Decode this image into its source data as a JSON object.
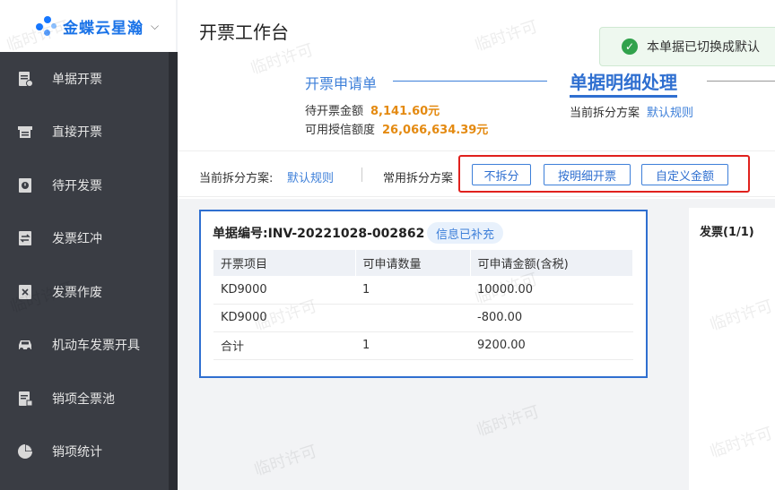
{
  "app": {
    "logo_text": "金蝶云星瀚",
    "page_title": "开票工作台",
    "watermark": "临时许可"
  },
  "sidebar": {
    "items": [
      {
        "label": "单据开票",
        "icon": "document-icon"
      },
      {
        "label": "直接开票",
        "icon": "printer-icon"
      },
      {
        "label": "待开发票",
        "icon": "pending-invoice-icon"
      },
      {
        "label": "发票红冲",
        "icon": "swap-icon"
      },
      {
        "label": "发票作废",
        "icon": "void-icon"
      },
      {
        "label": "机动车发票开具",
        "icon": "car-icon"
      },
      {
        "label": "销项全票池",
        "icon": "invoice-pool-icon"
      },
      {
        "label": "销项统计",
        "icon": "pie-chart-icon"
      }
    ]
  },
  "toast": {
    "text": "本单据已切换成默认"
  },
  "steps": {
    "step1_label": "开票申请单",
    "step2_label": "单据明细处理",
    "pending_amount_label": "待开票金额",
    "pending_amount_value": "8,141.60元",
    "credit_label": "可用授信额度",
    "credit_value": "26,066,634.39元",
    "current_plan_label": "当前拆分方案",
    "current_plan_value": "默认规则"
  },
  "split_bar": {
    "current_label": "当前拆分方案:",
    "current_value": "默认规则",
    "common_label": "常用拆分方案",
    "options": [
      "不拆分",
      "按明细开票",
      "自定义金额"
    ]
  },
  "detail": {
    "doc_no": "单据编号:INV-20221028-002862",
    "tag": "信息已补充",
    "columns": [
      "开票项目",
      "可申请数量",
      "可申请金额(含税)"
    ],
    "rows": [
      [
        "KD9000",
        "1",
        "10000.00"
      ],
      [
        "KD9000",
        "",
        "-800.00"
      ],
      [
        "合计",
        "1",
        "9200.00"
      ]
    ]
  },
  "invoice": {
    "title": "发票(1/1)"
  },
  "colors": {
    "accent": "#2f6fd0",
    "amount": "#e48a11",
    "highlight_box": "#e0211d",
    "success": "#31a24c"
  }
}
